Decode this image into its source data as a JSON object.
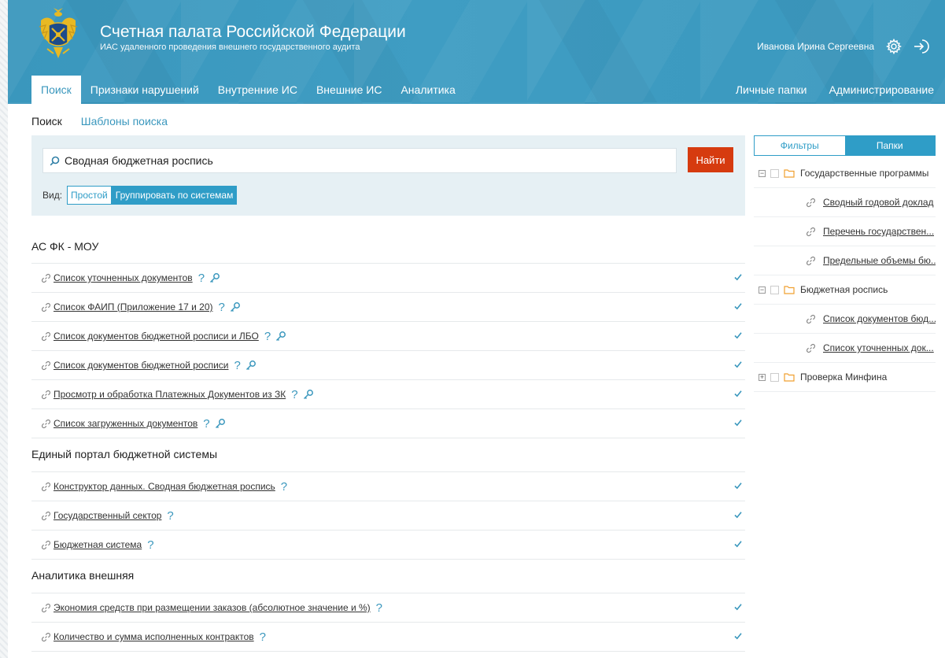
{
  "header": {
    "title": "Счетная палата Российской Федерации",
    "subtitle": "ИАС удаленного проведения внешнего государственного аудита",
    "user_name": "Иванова Ирина Сергеевна",
    "accent_color": "#3a97bd"
  },
  "nav": {
    "left": [
      {
        "label": "Поиск",
        "active": true
      },
      {
        "label": "Признаки нарушений"
      },
      {
        "label": "Внутренние ИС"
      },
      {
        "label": "Внешние ИС"
      },
      {
        "label": "Аналитика"
      }
    ],
    "right": [
      {
        "label": "Личные папки"
      },
      {
        "label": "Администрирование"
      }
    ]
  },
  "subtabs": [
    {
      "label": "Поиск",
      "active": true
    },
    {
      "label": "Шаблоны поиска"
    }
  ],
  "search": {
    "value": "Сводная бюджетная роспись",
    "button_label": "Найти",
    "button_color": "#d63b0f",
    "view_label": "Вид:",
    "view_options": [
      "Простой",
      "Группировать по системам"
    ],
    "selected_view": "Группировать по системам"
  },
  "groups": [
    {
      "title": "АС ФК - МОУ",
      "items": [
        {
          "label": "Список уточненных документов",
          "key": true
        },
        {
          "label": "Список ФАИП (Приложение 17 и 20)",
          "key": true
        },
        {
          "label": "Список документов бюджетной росписи и ЛБО",
          "key": true
        },
        {
          "label": "Список документов бюджетной росписи",
          "key": true
        },
        {
          "label": "Просмотр и обработка Платежных Документов из ЗК",
          "key": true
        },
        {
          "label": "Список загруженных документов",
          "key": true
        }
      ]
    },
    {
      "title": "Единый портал бюджетной системы",
      "items": [
        {
          "label": "Конструктор данных. Сводная бюджетная роспись",
          "key": false
        },
        {
          "label": "Государственный сектор",
          "key": false
        },
        {
          "label": "Бюджетная система",
          "key": false
        }
      ]
    },
    {
      "title": "Аналитика внешняя",
      "items": [
        {
          "label": "Экономия средств при размещении заказов (абсолютное значение и %)",
          "key": false
        },
        {
          "label": "Количество и сумма исполненных контрактов",
          "key": false
        }
      ]
    }
  ],
  "right_panel": {
    "tabs": [
      {
        "label": "Фильтры"
      },
      {
        "label": "Папки",
        "active": true
      }
    ],
    "folders": [
      {
        "label": "Государственные программы",
        "expanded": true,
        "toggle": "−",
        "children": [
          "Сводный годовой доклад",
          "Перечень государствен...",
          "Предельные объемы бю..."
        ]
      },
      {
        "label": "Бюджетная роспись",
        "expanded": true,
        "toggle": "−",
        "children": [
          "Список документов бюд...",
          "Список уточненных док..."
        ]
      },
      {
        "label": "Проверка Минфина",
        "expanded": false,
        "toggle": "+",
        "children": []
      }
    ]
  },
  "symbols": {
    "help": "?"
  }
}
